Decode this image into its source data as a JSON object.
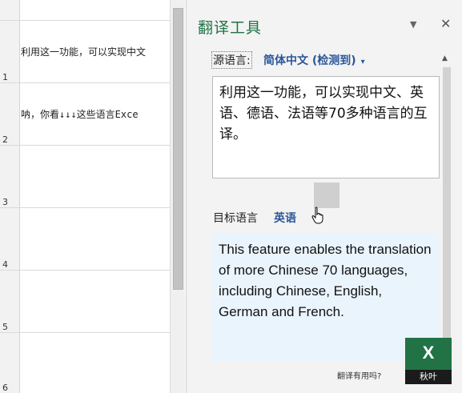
{
  "sheet": {
    "rows": [
      "1",
      "2",
      "3",
      "4",
      "5",
      "6"
    ],
    "cell_texts": [
      "利用这一功能，可以实现中文",
      "呐，你看↓↓↓这些语言Exce"
    ]
  },
  "pane": {
    "title": "翻译工具",
    "menu_icon": "▼",
    "close_icon": "✕",
    "source_label": "源语言:",
    "source_language": "简体中文 (检测到)",
    "source_caret": "▾",
    "source_text": "利用这一功能，可以实现中文、英语、德语、法语等70多种语言的互译。",
    "target_label": "目标语言",
    "target_language": "英语",
    "target_text": "This feature enables the translation of more Chinese 70 languages, including Chinese, English, German and French.",
    "feedback": "翻译有用吗?"
  },
  "logo": {
    "letter": "X",
    "caption": "秋叶"
  },
  "colors": {
    "accent_green": "#217346",
    "link_blue": "#2b579a",
    "target_bg": "#eaf4fd"
  }
}
